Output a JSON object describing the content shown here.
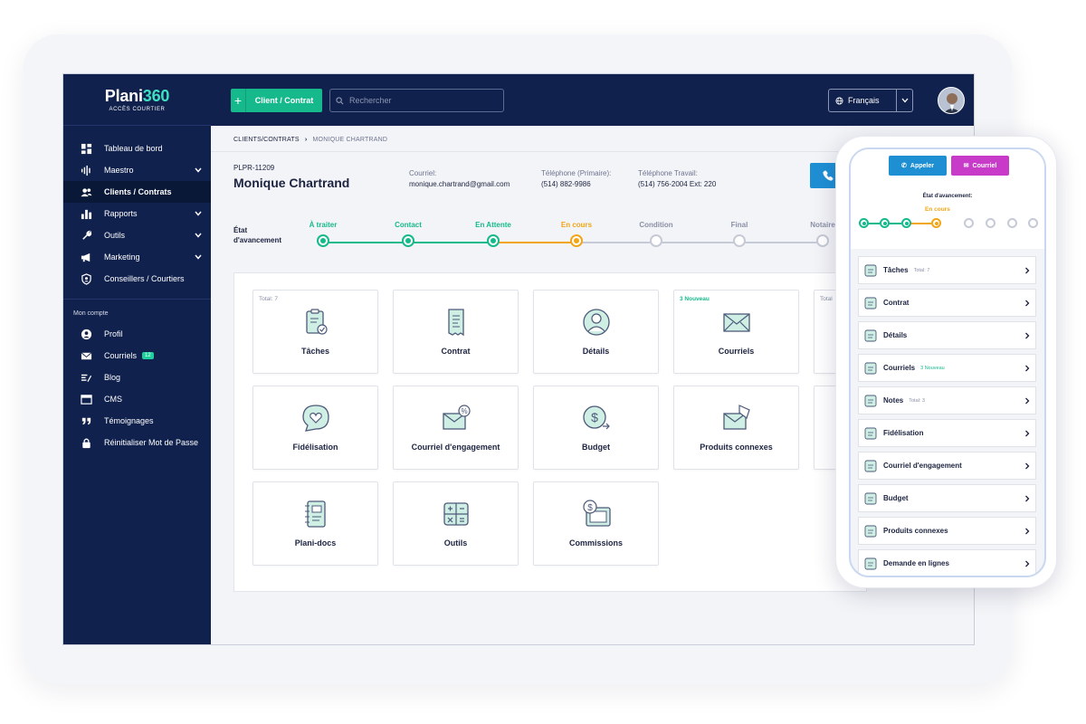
{
  "sidebar": {
    "logo": {
      "name_a": "Plani",
      "name_b": "360",
      "subtitle": "ACCÈS COURTIER"
    },
    "menu": [
      {
        "label": "Tableau de bord",
        "icon": "dashboard-icon"
      },
      {
        "label": "Maestro",
        "icon": "waveform-icon",
        "expandable": true
      },
      {
        "label": "Clients / Contrats",
        "icon": "users-icon",
        "active": true
      },
      {
        "label": "Rapports",
        "icon": "bar-chart-icon",
        "expandable": true
      },
      {
        "label": "Outils",
        "icon": "wrench-icon",
        "expandable": true
      },
      {
        "label": "Marketing",
        "icon": "megaphone-icon",
        "expandable": true
      },
      {
        "label": "Conseillers / Courtiers",
        "icon": "shield-user-icon"
      }
    ],
    "account_section": "Mon compte",
    "account": [
      {
        "label": "Profil",
        "icon": "user-circle-icon"
      },
      {
        "label": "Courriels",
        "icon": "mail-icon",
        "count": "12"
      },
      {
        "label": "Blog",
        "icon": "blog-icon"
      },
      {
        "label": "CMS",
        "icon": "window-icon"
      },
      {
        "label": "Témoignages",
        "icon": "quote-icon"
      },
      {
        "label": "Réinitialiser Mot de Passe",
        "icon": "lock-icon"
      }
    ]
  },
  "topbar": {
    "add_label": "Client / Contrat",
    "search_placeholder": "Rechercher",
    "language": "Français"
  },
  "breadcrumb": {
    "parent": "CLIENTS/CONTRATS",
    "current": "MONIQUE CHARTRAND"
  },
  "client": {
    "id": "PLPR-11209",
    "name": "Monique Chartrand",
    "email_label": "Courriel:",
    "email": "monique.chartrand@gmail.com",
    "phone_label": "Téléphone (Primaire):",
    "phone": "(514) 882-9986",
    "work_label": "Téléphone Travail:",
    "work": "(514) 756-2004  Ext: 220"
  },
  "progress": {
    "label_line1": "État",
    "label_line2": "d'avancement",
    "steps": [
      {
        "label": "À traiter",
        "state": "done"
      },
      {
        "label": "Contact",
        "state": "done"
      },
      {
        "label": "En Attente",
        "state": "done"
      },
      {
        "label": "En cours",
        "state": "current"
      },
      {
        "label": "Condition",
        "state": "todo"
      },
      {
        "label": "Final",
        "state": "todo"
      },
      {
        "label": "Notaire",
        "state": "todo"
      }
    ]
  },
  "cards": [
    {
      "title": "Tâches",
      "tag": "Total: 7",
      "icon": "clipboard-check-icon"
    },
    {
      "title": "Contrat",
      "tag": "",
      "icon": "receipt-icon"
    },
    {
      "title": "Détails",
      "tag": "",
      "icon": "user-circle-icon"
    },
    {
      "title": "Courriels",
      "tag": "3 Nouveau",
      "tag_new": true,
      "icon": "envelope-icon"
    },
    {
      "title": "",
      "tag": "Total",
      "icon": ""
    },
    {
      "title": "Fidélisation",
      "tag": "",
      "icon": "heart-bubble-icon"
    },
    {
      "title": "Courriel d'engagement",
      "tag": "",
      "icon": "envelope-percent-icon"
    },
    {
      "title": "Budget",
      "tag": "",
      "icon": "dollar-coin-icon"
    },
    {
      "title": "Produits connexes",
      "tag": "",
      "icon": "envelope-tag-icon"
    },
    {
      "title": "",
      "tag": "",
      "icon": ""
    },
    {
      "title": "Plani-docs",
      "tag": "",
      "icon": "notebook-icon"
    },
    {
      "title": "Outils",
      "tag": "",
      "icon": "calculator-icon"
    },
    {
      "title": "Commissions",
      "tag": "",
      "icon": "wallet-icon"
    }
  ],
  "phone": {
    "call_label": "Appeler",
    "mail_label": "Courriel",
    "progress_label": "État d'avancement:",
    "current_step": "En cours",
    "items": [
      {
        "title": "Tâches",
        "meta": "Total: 7"
      },
      {
        "title": "Contrat",
        "meta": ""
      },
      {
        "title": "Détails",
        "meta": ""
      },
      {
        "title": "Courriels",
        "meta": "3 Nouveau",
        "meta_new": true
      },
      {
        "title": "Notes",
        "meta": "Total: 3"
      },
      {
        "title": "Fidélisation",
        "meta": ""
      },
      {
        "title": "Courriel d'engagement",
        "meta": ""
      },
      {
        "title": "Budget",
        "meta": ""
      },
      {
        "title": "Produits connexes",
        "meta": ""
      },
      {
        "title": "Demande en lignes",
        "meta": ""
      }
    ]
  },
  "colors": {
    "navy": "#10214d",
    "green": "#16b98c",
    "orange": "#f2a516",
    "blue": "#1f8fd4",
    "magenta": "#c83bc8"
  }
}
